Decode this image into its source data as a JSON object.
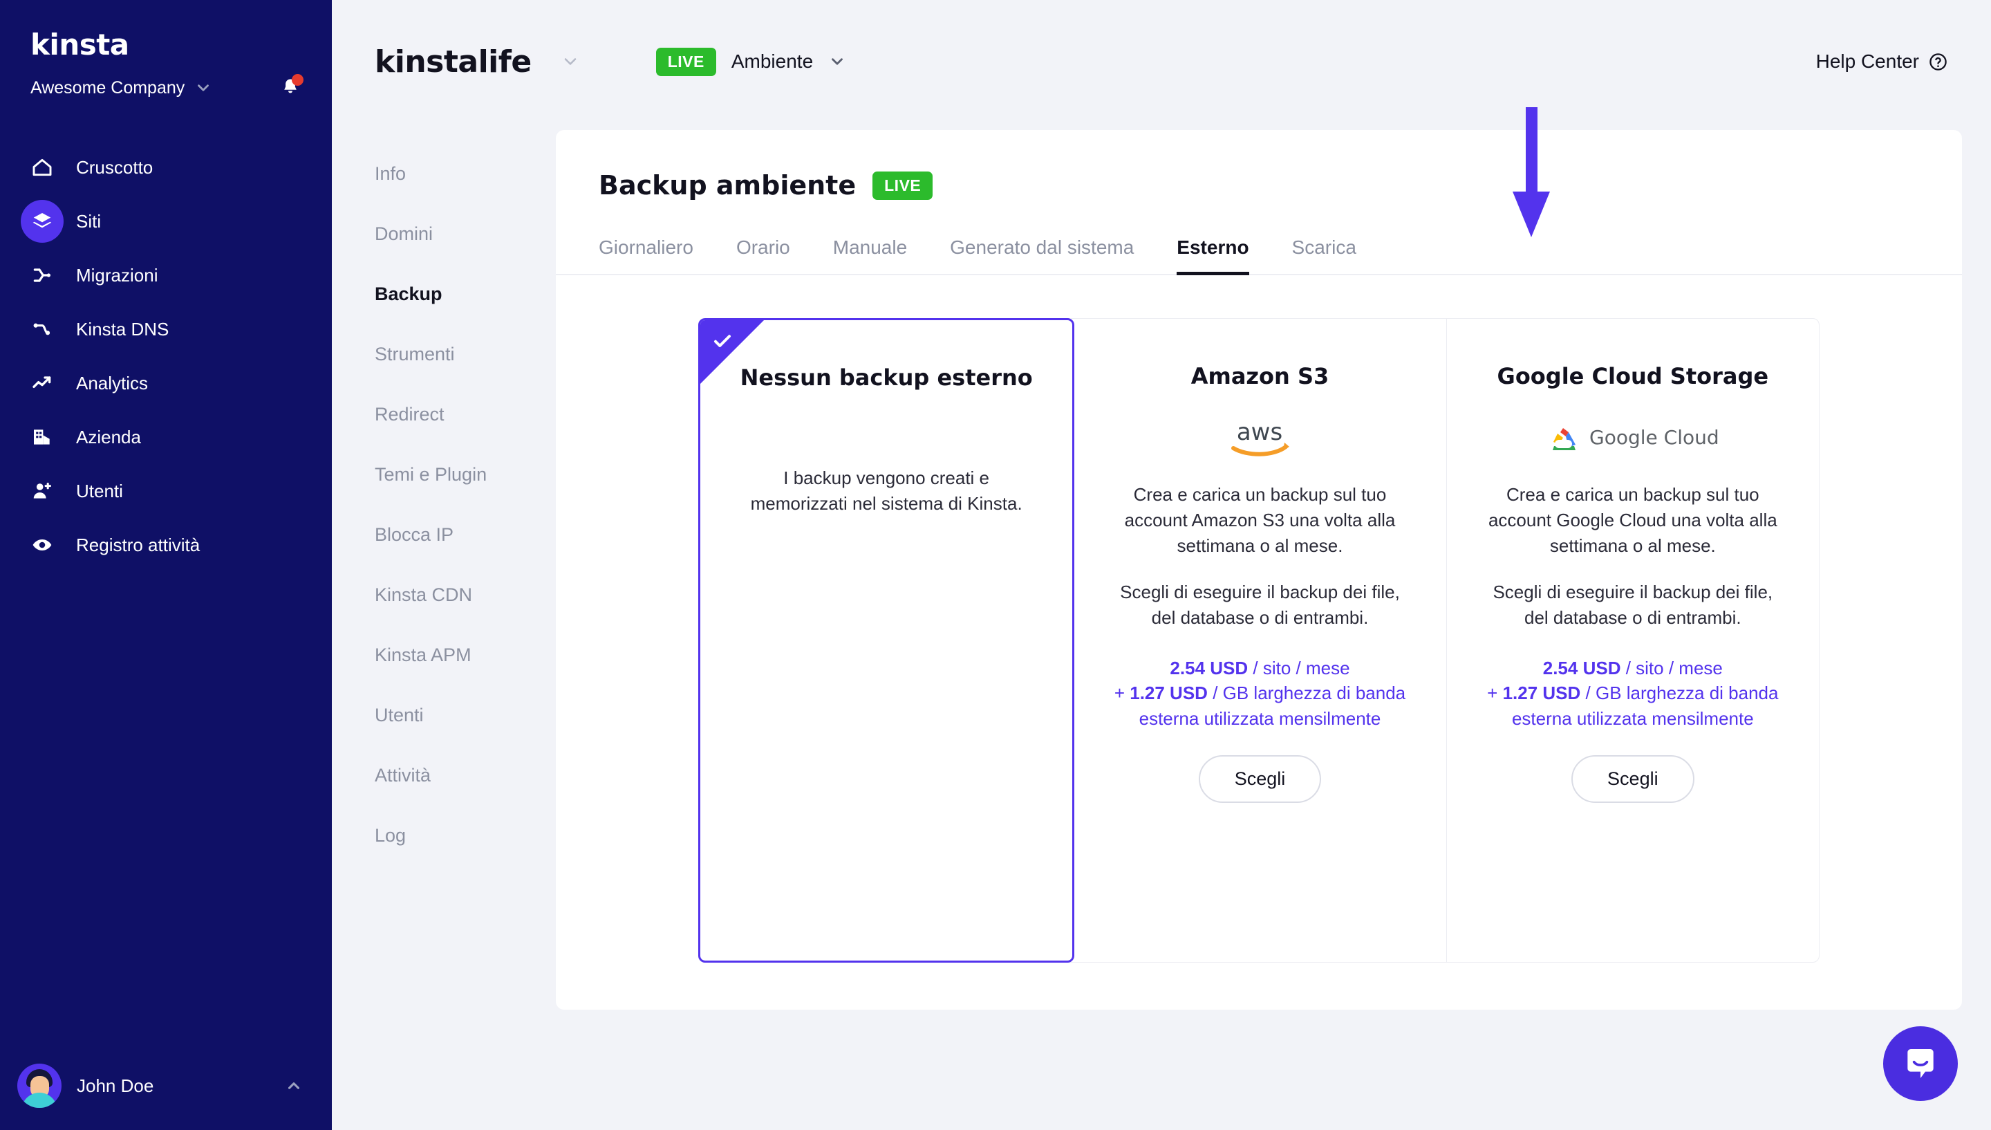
{
  "sidebar": {
    "logo": "kinsta",
    "company": "Awesome Company",
    "company_chevron_icon": "chevron-down-icon",
    "bell_icon": "bell-icon",
    "items": [
      {
        "label": "Cruscotto",
        "icon": "home-icon",
        "active": false
      },
      {
        "label": "Siti",
        "icon": "layers-icon",
        "active": true
      },
      {
        "label": "Migrazioni",
        "icon": "merge-icon",
        "active": false
      },
      {
        "label": "Kinsta DNS",
        "icon": "dns-nodes-icon",
        "active": false
      },
      {
        "label": "Analytics",
        "icon": "trend-up-icon",
        "active": false
      },
      {
        "label": "Azienda",
        "icon": "building-icon",
        "active": false
      },
      {
        "label": "Utenti",
        "icon": "user-plus-icon",
        "active": false
      },
      {
        "label": "Registro attività",
        "icon": "eye-icon",
        "active": false
      }
    ],
    "user": {
      "name": "John Doe",
      "chevron_icon": "chevron-up-icon",
      "avatar": "avatar"
    }
  },
  "topbar": {
    "site_name": "kinstalife",
    "site_chevron_icon": "chevron-down-icon",
    "env_badge": "LIVE",
    "env_label": "Ambiente",
    "env_chevron_icon": "chevron-down-icon",
    "help_center": "Help Center",
    "help_icon": "question-circle-icon"
  },
  "submenu": {
    "items": [
      {
        "label": "Info",
        "active": false
      },
      {
        "label": "Domini",
        "active": false
      },
      {
        "label": "Backup",
        "active": true
      },
      {
        "label": "Strumenti",
        "active": false
      },
      {
        "label": "Redirect",
        "active": false
      },
      {
        "label": "Temi e Plugin",
        "active": false
      },
      {
        "label": "Blocca IP",
        "active": false
      },
      {
        "label": "Kinsta CDN",
        "active": false
      },
      {
        "label": "Kinsta APM",
        "active": false
      },
      {
        "label": "Utenti",
        "active": false
      },
      {
        "label": "Attività",
        "active": false
      },
      {
        "label": "Log",
        "active": false
      }
    ]
  },
  "content": {
    "title": "Backup ambiente",
    "badge": "LIVE",
    "tabs": [
      {
        "label": "Giornaliero",
        "active": false
      },
      {
        "label": "Orario",
        "active": false
      },
      {
        "label": "Manuale",
        "active": false
      },
      {
        "label": "Generato dal sistema",
        "active": false
      },
      {
        "label": "Esterno",
        "active": true
      },
      {
        "label": "Scarica",
        "active": false
      }
    ],
    "options": [
      {
        "title": "Nessun backup esterno",
        "selected": true,
        "check_icon": "check-icon",
        "body": "I backup vengono creati e memorizzati nel sistema di Kinsta."
      },
      {
        "title": "Amazon S3",
        "selected": false,
        "logo": "aws-logo",
        "desc1": "Crea e carica un backup sul tuo account Amazon S3 una volta alla settimana o al mese.",
        "desc2": "Scegli di eseguire il backup dei file, del database o di entrambi.",
        "price_amount": "2.54 USD",
        "price_unit": " / sito / mese",
        "price_extra_prefix": "+ ",
        "price_extra_amount": "1.27 USD",
        "price_extra_unit": " / GB larghezza di banda esterna utilizzata mensilmente",
        "button": "Scegli"
      },
      {
        "title": "Google Cloud Storage",
        "selected": false,
        "logo": "google-cloud-logo",
        "logo_text": "Google Cloud",
        "desc1": "Crea e carica un backup sul tuo account Google Cloud una volta alla settimana o al mese.",
        "desc2": "Scegli di eseguire il backup dei file, del database o di entrambi.",
        "price_amount": "2.54 USD",
        "price_unit": " / sito / mese",
        "price_extra_prefix": "+ ",
        "price_extra_amount": "1.27 USD",
        "price_extra_unit": " / GB larghezza di banda esterna utilizzata mensilmente",
        "button": "Scegli"
      }
    ]
  },
  "annotation": {
    "arrow_icon": "down-arrow-annotation",
    "color": "#5333ED"
  },
  "chat": {
    "icon": "intercom-chat-icon",
    "color": "#4A2DE0"
  },
  "colors": {
    "sidebar_bg": "#0F1066",
    "page_bg": "#F2F3F8",
    "accent_purple": "#5333ED",
    "live_green": "#2CBB2C",
    "notification_red": "#E63B2E",
    "muted_text": "#8B90A0"
  }
}
